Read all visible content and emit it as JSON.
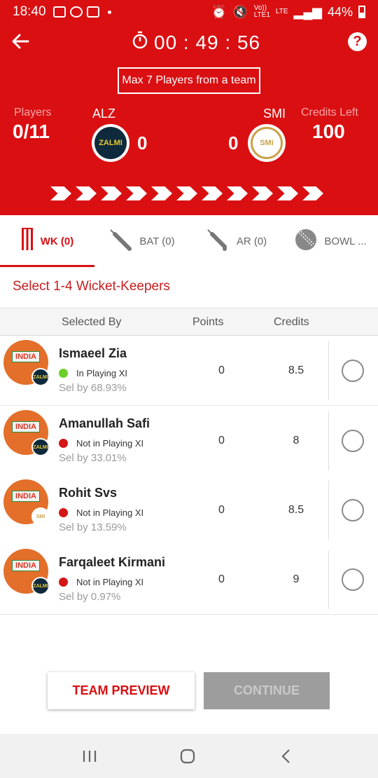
{
  "status_bar": {
    "time": "18:40",
    "network_top": "Vo))",
    "network_bottom": "LTE1",
    "lte_top": "LTE",
    "battery": "44%"
  },
  "header": {
    "timer": "00 : 49 : 56",
    "max_players_note": "Max 7 Players from a team",
    "players_label": "Players",
    "players_value": "0/11",
    "credits_label": "Credits Left",
    "credits_value": "100"
  },
  "teams": {
    "left": {
      "code": "ALZ",
      "count": "0",
      "logo_text": "ZALMI"
    },
    "right": {
      "code": "SMI",
      "count": "0",
      "logo_text": "SMi"
    }
  },
  "tabs": [
    {
      "label": "WK (0)",
      "icon": "wicket-icon",
      "active": true
    },
    {
      "label": "BAT (0)",
      "icon": "bat-icon",
      "active": false
    },
    {
      "label": "AR (0)",
      "icon": "all-rounder-icon",
      "active": false
    },
    {
      "label": "BOWL ...",
      "icon": "ball-icon",
      "active": false
    }
  ],
  "instruction": "Select 1-4 Wicket-Keepers",
  "columns": {
    "selected_by": "Selected By",
    "points": "Points",
    "credits": "Credits"
  },
  "players": [
    {
      "name": "Ismaeel Zia",
      "status": "In Playing XI",
      "sel": "Sel by 68.93%",
      "points": "0",
      "credits": "8.5",
      "team": "ZALMI",
      "avatar_tag": "INDIA"
    },
    {
      "name": "Amanullah Safi",
      "status": "Not in Playing XI",
      "sel": "Sel by 33.01%",
      "points": "0",
      "credits": "8",
      "team": "ZALMI",
      "avatar_tag": "INDIA"
    },
    {
      "name": "Rohit Svs",
      "status": "Not in Playing XI",
      "sel": "Sel by 13.59%",
      "points": "0",
      "credits": "8.5",
      "team": "SMI",
      "avatar_tag": "INDIA"
    },
    {
      "name": "Farqaleet Kirmani",
      "status": "Not in Playing XI",
      "sel": "Sel by 0.97%",
      "points": "0",
      "credits": "9",
      "team": "ZALMI",
      "avatar_tag": "INDIA"
    }
  ],
  "buttons": {
    "preview": "TEAM PREVIEW",
    "continue": "CONTINUE"
  },
  "colors": {
    "brand_red": "#d90f12",
    "in_xi": "#6bd12a",
    "not_in_xi": "#d41616"
  }
}
